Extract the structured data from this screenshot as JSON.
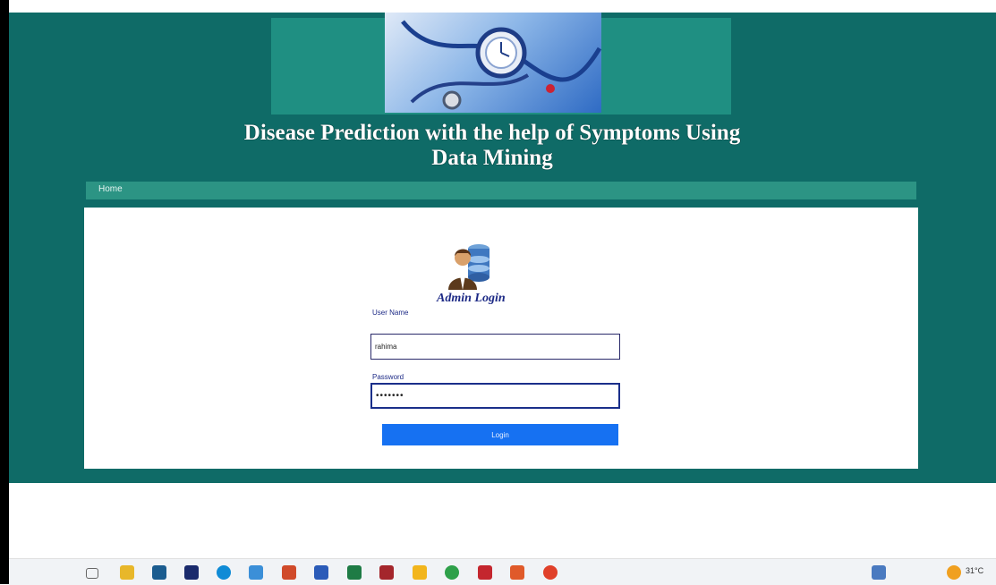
{
  "site": {
    "title_line1": "Disease Prediction with the help of Symptoms Using",
    "title_line2": "Data Mining"
  },
  "nav": {
    "home_label": "Home"
  },
  "login": {
    "title": "Admin Login",
    "username_label": "User Name",
    "username_value": "rahima",
    "password_label": "Password",
    "password_value": "•••••••",
    "button_label": "Login"
  },
  "taskbar": {
    "icons": [
      "task-view-icon",
      "file-explorer-icon",
      "store-icon",
      "app-icon",
      "edge-icon",
      "folder-icon",
      "powerpoint-icon",
      "word-icon",
      "excel-icon",
      "access-icon",
      "outlook-icon",
      "chrome-icon",
      "media-icon",
      "paint-icon",
      "app-red-icon",
      "network-icon",
      "weather-icon"
    ],
    "temperature": "31°C"
  },
  "colors": {
    "app_bg": "#0f6b67",
    "banner_bg": "#1f8f82",
    "navbar_bg": "#2c9484",
    "button_bg": "#1671f2",
    "login_title": "#1d2a86"
  }
}
